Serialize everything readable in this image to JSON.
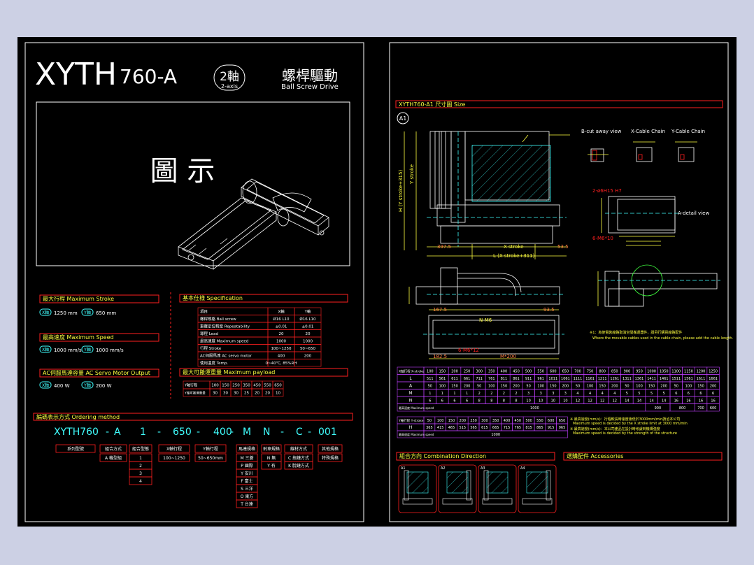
{
  "sheet": {
    "model": "XYTH",
    "model_suffix": "760-A",
    "axes_badge": "2軸",
    "axes_badge_sub": "2-axis",
    "drive_cn": "螺桿驅動",
    "drive_en": "Ball Screw Drive",
    "illustration_label": "圖 示"
  },
  "max_stroke": {
    "title": "最大行程 Maximum Stroke",
    "x_badge": "X軸",
    "x_value": "1250 mm",
    "y_badge": "Y軸",
    "y_value": "650 mm"
  },
  "max_speed": {
    "title": "最高速度 Maximum Speed",
    "x_badge": "X軸",
    "x_value": "1000 mm/s",
    "y_badge": "Y軸",
    "y_value": "1000 mm/s"
  },
  "motor_output": {
    "title": "AC伺服馬達容量 AC Servo Motor Output",
    "x_badge": "X軸",
    "x_value": "400 W",
    "y_badge": "Y軸",
    "y_value": "200 W"
  },
  "spec": {
    "title": "基本仕様 Specification",
    "headers": [
      "項目",
      "X軸",
      "Y軸"
    ],
    "rows": [
      [
        "螺桿規格 Ball screw",
        "Ø16 L10",
        "Ø16 L10"
      ],
      [
        "重覆定位精度 Repeatability",
        "±0.01",
        "±0.01"
      ],
      [
        "導程 Lead",
        "20",
        "20"
      ],
      [
        "最高速度 Maximum speed",
        "1000",
        "1000"
      ],
      [
        "行程 Stroke",
        "100~1250",
        "50~650"
      ],
      [
        "AC伺服馬達 AC servo motor",
        "400",
        "200"
      ],
      [
        "使用溫度 Temp.",
        "0~40℃, 85%RH",
        ""
      ]
    ]
  },
  "max_payload": {
    "title": "最大可搬運重量 Maximum payload",
    "row_label_1": "Y軸行程",
    "row_label_2": "Y軸可搬運重量",
    "strokes": [
      "100",
      "150",
      "250",
      "350",
      "450",
      "550",
      "650"
    ],
    "loads": [
      "30",
      "30",
      "30",
      "25",
      "20",
      "20",
      "10"
    ]
  },
  "ordering": {
    "title": "編碼表示方式 Ordering method",
    "code_parts": [
      "XYTH760",
      "-",
      "A",
      "1",
      "-",
      "650",
      "-",
      "400",
      "-",
      "M",
      "N",
      "-",
      "C",
      "-",
      "001"
    ],
    "labels": [
      "系列型號",
      "組合方式",
      "組合型態",
      "X軸行程",
      "Y軸行程",
      "馬達規格",
      "剎車規格",
      "線材方式",
      "其他規格"
    ],
    "combo_value": "A 機型組",
    "combo_types": [
      "1",
      "2",
      "3",
      "4"
    ],
    "x_stroke": "100~1250",
    "y_stroke": "50~650mm",
    "motors": [
      "M 三菱",
      "P 國際",
      "Y 安川",
      "F 富士",
      "S 三洋",
      "O 東方",
      "T 台達"
    ],
    "brakes": [
      "N 無",
      "Y 有"
    ],
    "cables": [
      "C 拖鏈方式",
      "K 脫鏈方式"
    ],
    "other": "特殊規格"
  },
  "size": {
    "title": "XYTH760-A1 尺寸圖 Size",
    "marker": "A1",
    "labels": {
      "bcut": "B-cut away view",
      "xcable": "X-Cable Chain",
      "ycable": "Y-Cable Chain",
      "adetail": "A-detail view",
      "xstroke": "X stroke",
      "ystroke": "Y stroke",
      "lstroke": "L (X stroke+311)",
      "hstroke": "H (Y stroke+315)",
      "d1": "397.5",
      "d2": "53.5",
      "d3": "167.5",
      "d4": "93.5",
      "d5": "182.5",
      "d6": "M*200",
      "d7": "N-M6",
      "d8": "6-M6*12",
      "d9": "2-ø6H15 H7",
      "d10": "6-M6*10"
    },
    "note_1": "※1：為使電裝線路取消空間搬運器件，請另行購買線路配件",
    "note_2": "Where the movable cables used in the cable chain, please add the cable length."
  },
  "x_table": {
    "header_label": "X軸行程 X-stroke",
    "strokes": [
      "100",
      "150",
      "200",
      "250",
      "300",
      "350",
      "400",
      "450",
      "500",
      "550",
      "600",
      "650",
      "700",
      "750",
      "800",
      "850",
      "900",
      "950",
      "1000",
      "1050",
      "1100",
      "1150",
      "1200",
      "1250"
    ],
    "L": [
      "511",
      "561",
      "611",
      "661",
      "711",
      "761",
      "811",
      "861",
      "911",
      "961",
      "1011",
      "1061",
      "1111",
      "1161",
      "1211",
      "1261",
      "1311",
      "1361",
      "1411",
      "1461",
      "1511",
      "1561",
      "1611",
      "1661"
    ],
    "A": [
      "50",
      "100",
      "150",
      "200",
      "50",
      "100",
      "150",
      "200",
      "50",
      "100",
      "150",
      "200",
      "50",
      "100",
      "150",
      "200",
      "50",
      "100",
      "150",
      "200",
      "50",
      "100",
      "150",
      "200"
    ],
    "M": [
      "1",
      "1",
      "1",
      "1",
      "2",
      "2",
      "2",
      "2",
      "3",
      "3",
      "3",
      "3",
      "4",
      "4",
      "4",
      "4",
      "5",
      "5",
      "5",
      "5",
      "6",
      "6",
      "6",
      "6"
    ],
    "N": [
      "6",
      "6",
      "6",
      "6",
      "8",
      "8",
      "8",
      "8",
      "10",
      "10",
      "10",
      "10",
      "12",
      "12",
      "12",
      "12",
      "14",
      "14",
      "14",
      "14",
      "16",
      "16",
      "16",
      "16"
    ],
    "speed_label": "最高速度 Maximum speed",
    "speeds": [
      "1000",
      "900",
      "800",
      "700",
      "600"
    ],
    "row_names": [
      "L",
      "A",
      "M",
      "N"
    ]
  },
  "y_table": {
    "header_label": "Y軸行程 Y-stroke",
    "strokes": [
      "50",
      "100",
      "150",
      "200",
      "250",
      "300",
      "350",
      "400",
      "450",
      "500",
      "550",
      "600",
      "650"
    ],
    "H": [
      "365",
      "415",
      "465",
      "515",
      "565",
      "615",
      "665",
      "715",
      "765",
      "815",
      "865",
      "915",
      "965"
    ],
    "speed_label": "最高速度 Maximum speed",
    "speed": "1000",
    "row_name": "H",
    "note_1": "※ 最高速度(mm/s)：行程較長時速度會低於3000mm/min請洽本公司",
    "note_2": "Maximum speed is decided by the X stroke limit at 3000 mm/min",
    "note_3": "※ 最高速度(mm/s)：本公司產品在設計時考慮到機構強度",
    "note_4": "Maximum speed is decided by the strength of the structure"
  },
  "combination": {
    "title": "組合方向 Combination Direction",
    "items": [
      "A1",
      "A2",
      "A3",
      "A4"
    ]
  },
  "accessories": {
    "title": "選購配件 Accessories"
  }
}
